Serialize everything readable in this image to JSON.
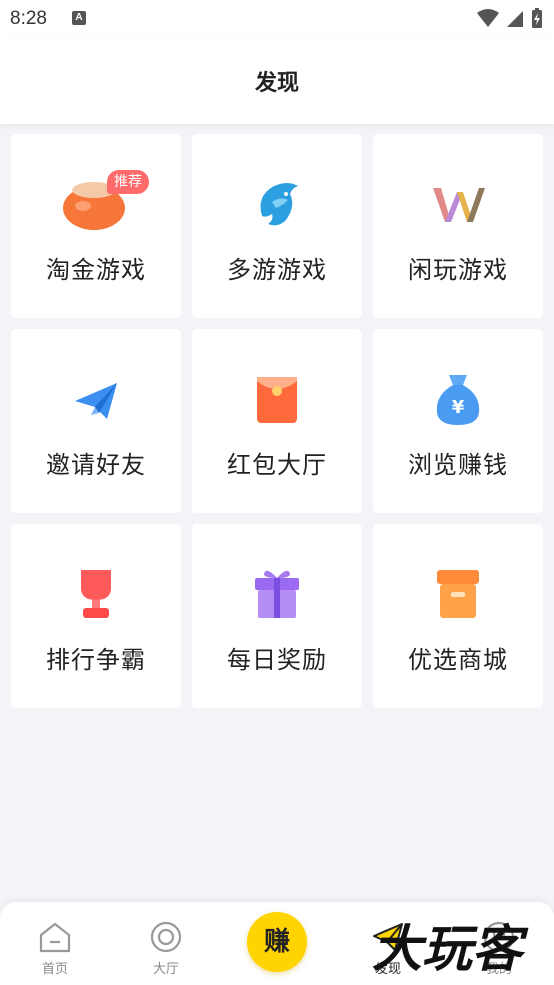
{
  "status_bar": {
    "time": "8:28",
    "notification_icon": "A"
  },
  "header": {
    "title": "发现"
  },
  "grid": {
    "items": [
      {
        "label": "淘金游戏",
        "icon": "gold-pot-icon",
        "badge": "推荐"
      },
      {
        "label": "多游游戏",
        "icon": "dolphin-icon"
      },
      {
        "label": "闲玩游戏",
        "icon": "xianwan-logo-icon"
      },
      {
        "label": "邀请好友",
        "icon": "paper-plane-icon"
      },
      {
        "label": "红包大厅",
        "icon": "red-envelope-icon"
      },
      {
        "label": "浏览赚钱",
        "icon": "money-bag-icon"
      },
      {
        "label": "排行争霸",
        "icon": "trophy-icon"
      },
      {
        "label": "每日奖励",
        "icon": "gift-icon"
      },
      {
        "label": "优选商城",
        "icon": "shop-box-icon"
      }
    ]
  },
  "bottom_nav": {
    "items": [
      {
        "label": "首页",
        "icon": "home-icon"
      },
      {
        "label": "大厅",
        "icon": "hall-circle-icon"
      },
      {
        "label": "赚",
        "icon": "earn-center-button"
      },
      {
        "label": "发现",
        "icon": "discover-plane-icon",
        "active": true
      },
      {
        "label": "我的",
        "icon": "profile-icon"
      }
    ]
  },
  "watermark": {
    "text": "大玩客"
  },
  "colors": {
    "background": "#f3f4f8",
    "accent_yellow": "#ffd400",
    "badge_red": "#ff6b6b"
  }
}
